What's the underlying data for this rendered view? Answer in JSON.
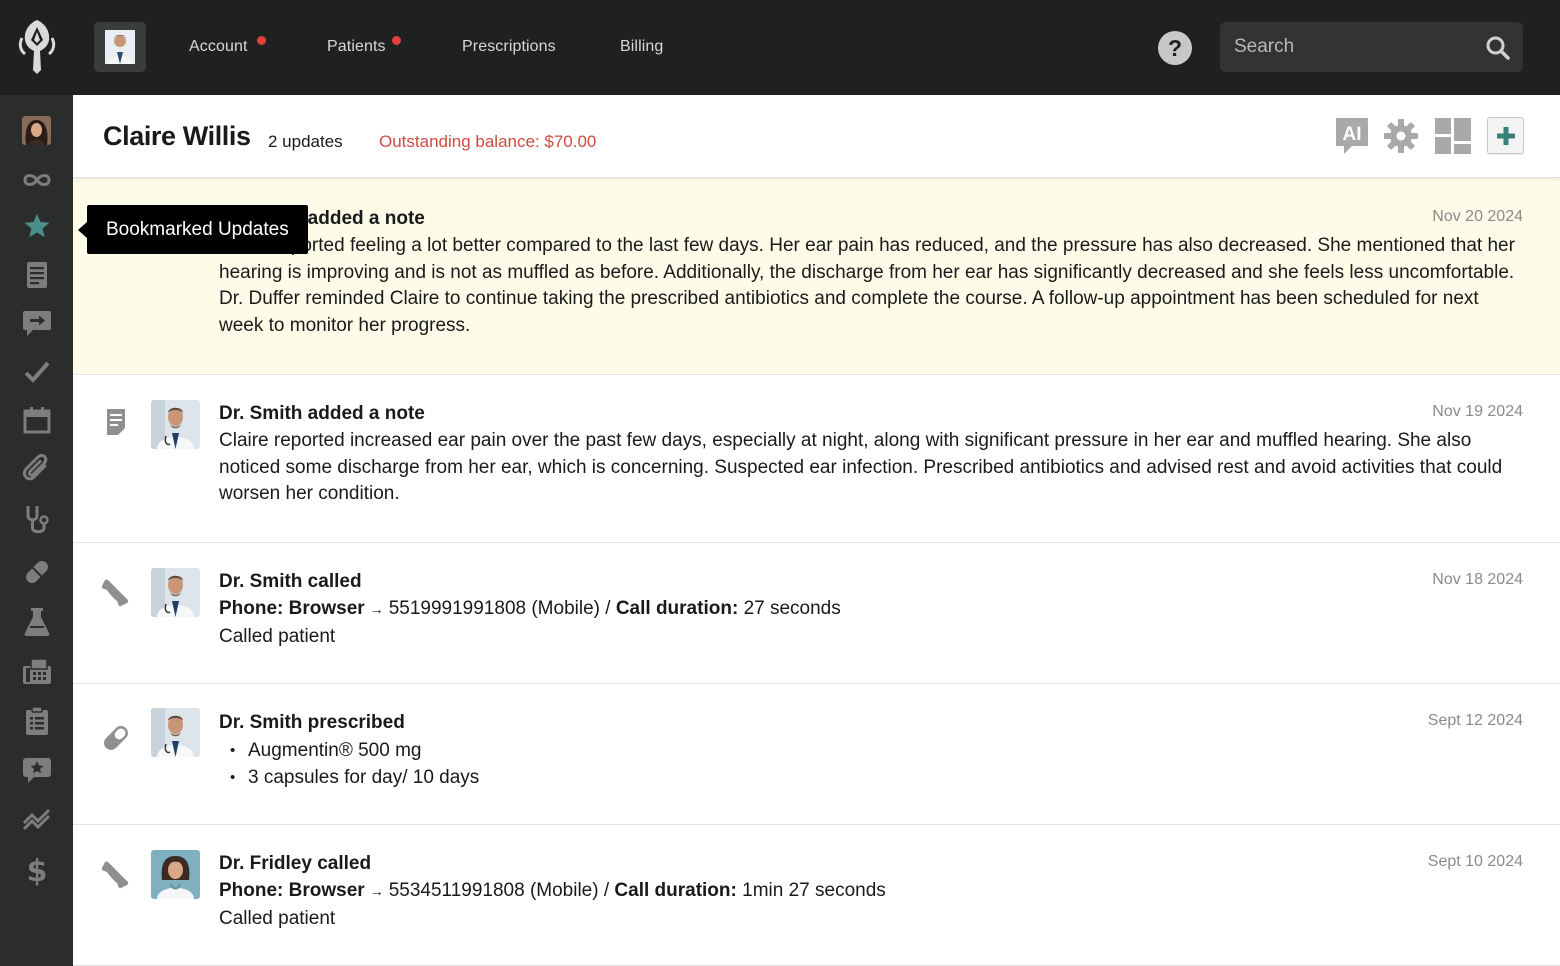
{
  "nav": {
    "items": [
      {
        "label": "Account",
        "has_dot": true
      },
      {
        "label": "Patients",
        "has_dot": true
      },
      {
        "label": "Prescriptions",
        "has_dot": false
      },
      {
        "label": "Billing",
        "has_dot": false
      }
    ],
    "help_label": "?",
    "search_placeholder": "Search",
    "dot_color": "#e2403a"
  },
  "sidebar": {
    "items": [
      {
        "icon": "patient-avatar",
        "active": false
      },
      {
        "icon": "infinity-icon",
        "active": false
      },
      {
        "icon": "star-icon",
        "active": true
      },
      {
        "icon": "document-icon",
        "active": false
      },
      {
        "icon": "message-arrow-icon",
        "active": false
      },
      {
        "icon": "checkmark-icon",
        "active": false
      },
      {
        "icon": "calendar-icon",
        "active": false
      },
      {
        "icon": "paperclip-icon",
        "active": false
      },
      {
        "icon": "stethoscope-icon",
        "active": false
      },
      {
        "icon": "pill-icon",
        "active": false
      },
      {
        "icon": "flask-icon",
        "active": false
      },
      {
        "icon": "fax-icon",
        "active": false
      },
      {
        "icon": "clipboard-icon",
        "active": false
      },
      {
        "icon": "star-chat-icon",
        "active": false
      },
      {
        "icon": "trend-icon",
        "active": false
      },
      {
        "icon": "dollar-icon",
        "active": false
      }
    ],
    "tooltip": "Bookmarked Updates",
    "active_color": "#4a8f8c"
  },
  "header": {
    "patient_name": "Claire Willis",
    "updates": "2 updates",
    "balance": "Outstanding balance: $70.00",
    "ai_label": "AI",
    "accent_color": "#cf4b40"
  },
  "feed": [
    {
      "type": "note",
      "icon": "note-icon",
      "title": "Dr. Smith added a note",
      "date": "Nov 20 2024",
      "highlighted": true,
      "body": "Claire reported feeling a lot better compared to the last few days. Her ear pain has reduced, and the pressure has also decreased. She mentioned that her hearing is improving and is not as muffled as before. Additionally, the discharge from her ear has significantly decreased and she feels less uncomfortable. Dr. Duffer reminded Claire to continue taking the prescribed antibiotics and complete the course. A follow-up appointment has been scheduled for next week to monitor her progress."
    },
    {
      "type": "note",
      "icon": "note-icon",
      "title": "Dr. Smith added a note",
      "date": "Nov 19 2024",
      "highlighted": false,
      "body": "Claire reported increased ear pain over the past few days, especially at night, along with significant pressure in her ear and muffled hearing. She also noticed some discharge from her ear, which is concerning. Suspected ear infection. Prescribed antibiotics and advised rest and avoid activities that could worsen her condition."
    },
    {
      "type": "call",
      "icon": "phone-icon",
      "title": "Dr. Smith called",
      "date": "Nov 18 2024",
      "phone_label": "Phone: Browser",
      "arrow": "→",
      "number": "5519991991808 (Mobile) /",
      "duration_label": "Call duration:",
      "duration": "27 seconds",
      "note": "Called patient"
    },
    {
      "type": "prescription",
      "icon": "pill-icon",
      "title": "Dr. Smith prescribed",
      "date": "Sept 12 2024",
      "items": [
        "Augmentin® 500 mg",
        "3 capsules for day/ 10 days"
      ]
    },
    {
      "type": "call",
      "icon": "phone-icon",
      "title": "Dr. Fridley called",
      "date": "Sept 10 2024",
      "phone_label": "Phone: Browser",
      "arrow": "→",
      "number": "5534511991808 (Mobile) /",
      "duration_label": "Call duration:",
      "duration": "1min 27 seconds",
      "note": "Called patient"
    }
  ]
}
